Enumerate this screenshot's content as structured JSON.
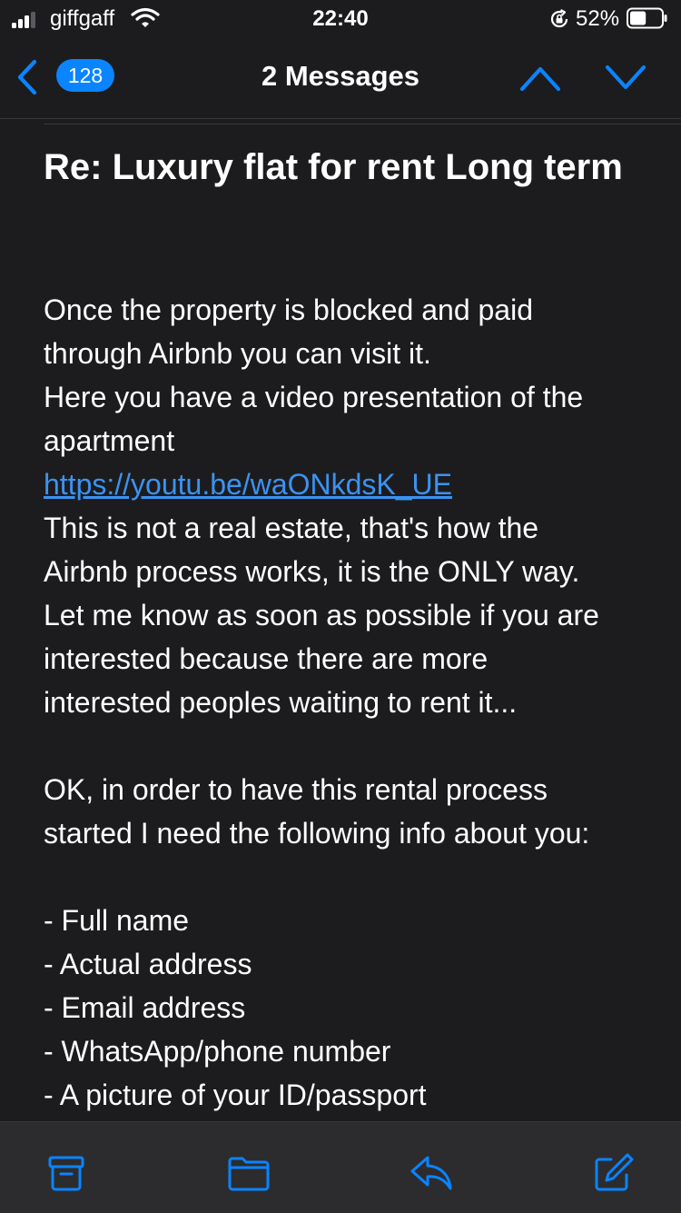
{
  "status_bar": {
    "carrier": "giffgaff",
    "time": "22:40",
    "battery_percent": "52%",
    "signal_bars_active": 3,
    "signal_bars_total": 4,
    "battery_level": 0.52,
    "icons": [
      "signal-icon",
      "wifi-icon",
      "rotation-lock-icon",
      "battery-icon"
    ]
  },
  "nav": {
    "back_count": "128",
    "title": "2 Messages",
    "accent_color": "#0a84ff",
    "icons": [
      "chevron-left-icon",
      "chevron-up-icon",
      "chevron-down-icon"
    ]
  },
  "message": {
    "subject": "Re: Luxury flat for rent Long term",
    "lines": [
      "Once the property is blocked and paid",
      "through Airbnb you can visit it.",
      "Here you have a video presentation of the",
      "apartment",
      "https://youtu.be/waONkdsK_UE",
      "This is not a real estate, that's how the",
      "Airbnb process works, it is the ONLY way.",
      "Let me know as soon as possible if you are",
      "interested because there are more",
      "interested peoples waiting to rent it...",
      "",
      "OK, in order to have this rental process",
      "started I need the following info about you:",
      "",
      "- Full name",
      "- Actual address",
      "- Email address",
      "- WhatsApp/phone number",
      "- A picture of your ID/passport"
    ],
    "link_line_index": 4,
    "link_color": "#3b93f3"
  },
  "toolbar": {
    "icons": [
      "archive-icon",
      "folder-icon",
      "reply-icon",
      "compose-icon"
    ],
    "icon_color": "#0a84ff"
  }
}
